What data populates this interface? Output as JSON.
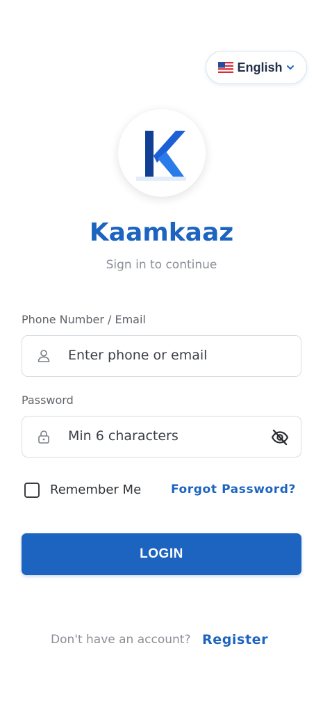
{
  "language_selector": {
    "flag_icon": "us-flag-icon",
    "label": "English",
    "chevron_icon": "chevron-down-icon"
  },
  "brand": {
    "logo_icon": "kaamkaaz-k-logo",
    "name": "Kaamkaaz",
    "subtitle": "Sign in to continue"
  },
  "form": {
    "identifier": {
      "label": "Phone Number / Email",
      "placeholder": "Enter phone or email",
      "icon": "user-icon"
    },
    "password": {
      "label": "Password",
      "placeholder": "Min 6 characters",
      "icon": "lock-icon",
      "toggle_icon": "eye-off-icon"
    },
    "remember_me": {
      "label": "Remember Me",
      "checked": false
    },
    "forgot_password": "Forgot Password?",
    "login_button": "LOGIN"
  },
  "footer": {
    "prompt": "Don't have an account?",
    "register_link": "Register"
  },
  "colors": {
    "primary": "#1c64c0",
    "muted_text": "#8a8f96",
    "border": "#d9dde2"
  }
}
